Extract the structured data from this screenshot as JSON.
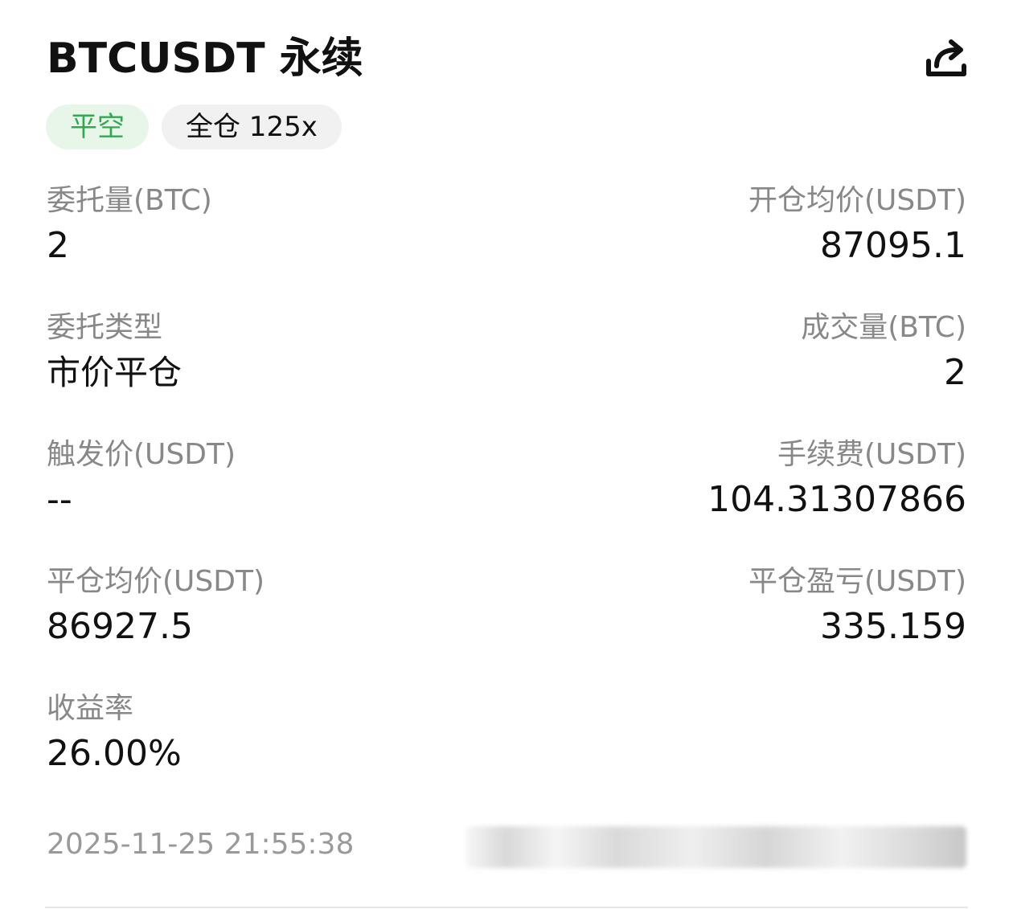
{
  "header": {
    "title": "BTCUSDT 永续",
    "share_icon": "share-icon"
  },
  "tags": {
    "side": "平空",
    "margin": "全仓 125x"
  },
  "fields": {
    "order_qty": {
      "label": "委托量(BTC)",
      "value": "2"
    },
    "open_avg_price": {
      "label": "开仓均价(USDT)",
      "value": "87095.1"
    },
    "order_type": {
      "label": "委托类型",
      "value": "市价平仓"
    },
    "filled_qty": {
      "label": "成交量(BTC)",
      "value": "2"
    },
    "trigger_price": {
      "label": "触发价(USDT)",
      "value": "--"
    },
    "fee": {
      "label": "手续费(USDT)",
      "value": "104.31307866"
    },
    "close_avg_price": {
      "label": "平仓均价(USDT)",
      "value": "86927.5"
    },
    "close_pnl": {
      "label": "平仓盈亏(USDT)",
      "value": "335.159"
    },
    "roi": {
      "label": "收益率",
      "value": "26.00%"
    }
  },
  "footer": {
    "timestamp": "2025-11-25 21:55:38"
  },
  "colors": {
    "accent_green": "#33a853",
    "green_tag_bg": "#e8f6ea",
    "grey_tag_bg": "#f1f1f1",
    "label_grey": "#888888"
  }
}
